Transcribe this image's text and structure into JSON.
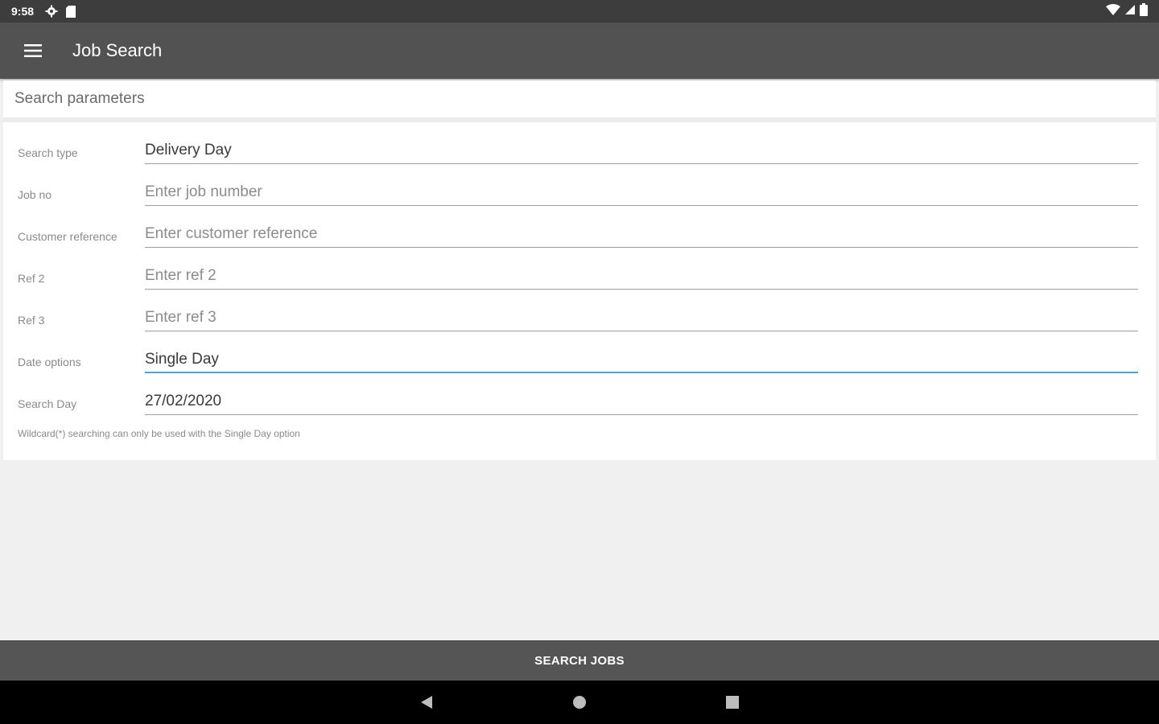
{
  "status_bar": {
    "time": "9:58",
    "icons": [
      "gear-icon",
      "sd-card-icon",
      "wifi-icon",
      "signal-icon",
      "battery-icon"
    ]
  },
  "app_bar": {
    "title": "Job Search",
    "menu_icon": "hamburger-menu-icon"
  },
  "form": {
    "header": "Search parameters",
    "fields": [
      {
        "label": "Search type",
        "value": "Delivery Day",
        "is_placeholder": false
      },
      {
        "label": "Job no",
        "value": "Enter job number",
        "is_placeholder": true
      },
      {
        "label": "Customer reference",
        "value": "Enter customer reference",
        "is_placeholder": true
      },
      {
        "label": "Ref 2",
        "value": "Enter ref 2",
        "is_placeholder": true
      },
      {
        "label": "Ref 3",
        "value": "Enter ref 3",
        "is_placeholder": true
      },
      {
        "label": "Date options",
        "value": "Single Day",
        "is_placeholder": false,
        "focused": true
      },
      {
        "label": "Search Day",
        "value": "27/02/2020",
        "is_placeholder": false
      }
    ],
    "note": "Wildcard(*) searching can only be used with the Single Day option"
  },
  "actions": {
    "search_label": "SEARCH JOBS"
  },
  "nav_bar": {
    "icons": [
      "back-icon",
      "home-icon",
      "recents-icon"
    ]
  },
  "colors": {
    "app_bar": "#525252",
    "status_bar": "#3d3d3d",
    "focus_underline": "#4aa3df",
    "button_bar": "#555555"
  }
}
